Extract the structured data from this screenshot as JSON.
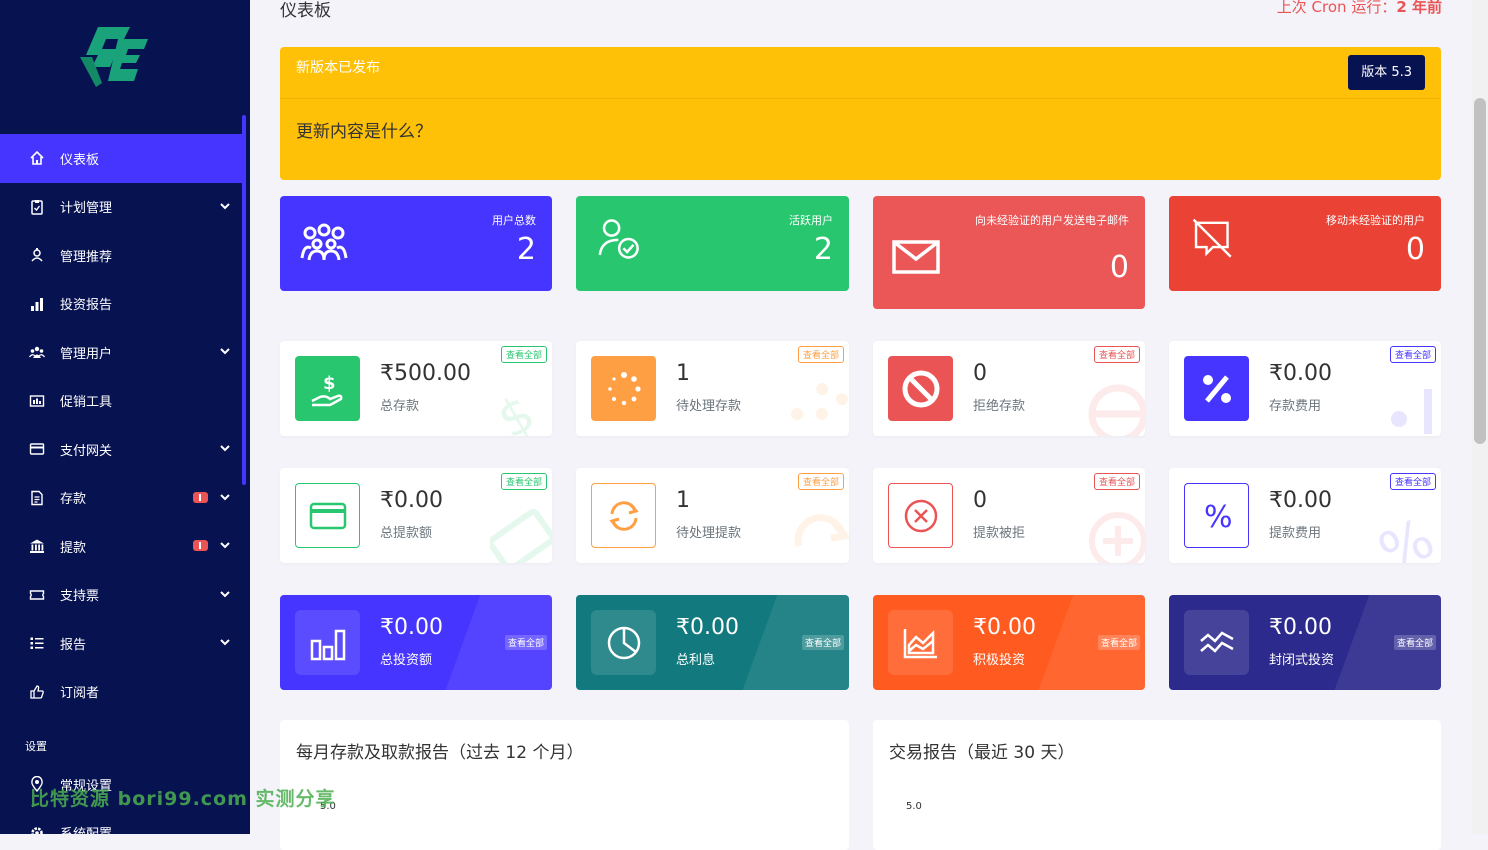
{
  "sidebar": {
    "items": [
      {
        "label": "仪表板",
        "icon": "home-icon",
        "active": true
      },
      {
        "label": "计划管理",
        "icon": "clipboard-icon",
        "has_submenu": true
      },
      {
        "label": "管理推荐",
        "icon": "referral-icon"
      },
      {
        "label": "投资报告",
        "icon": "bar-chart-icon"
      },
      {
        "label": "管理用户",
        "icon": "users-icon",
        "has_submenu": true
      },
      {
        "label": "促销工具",
        "icon": "promo-icon"
      },
      {
        "label": "支付网关",
        "icon": "credit-card-icon",
        "has_submenu": true
      },
      {
        "label": "存款",
        "icon": "deposit-icon",
        "has_submenu": true,
        "badge": "!"
      },
      {
        "label": "提款",
        "icon": "bank-icon",
        "has_submenu": true,
        "badge": "!"
      },
      {
        "label": "支持票",
        "icon": "ticket-icon",
        "has_submenu": true
      },
      {
        "label": "报告",
        "icon": "list-icon",
        "has_submenu": true
      },
      {
        "label": "订阅者",
        "icon": "thumbs-up-icon"
      }
    ],
    "settings_title": "设置",
    "settings_items": [
      {
        "label": "常规设置",
        "icon": "map-pin-icon"
      },
      {
        "label": "系统配置",
        "icon": "gear-icon"
      }
    ]
  },
  "header": {
    "title": "仪表板",
    "cron_label": "上次 Cron 运行：",
    "cron_value": "2 年前"
  },
  "notice": {
    "title": "新版本已发布",
    "version": "版本 5.3",
    "body": "更新内容是什么？"
  },
  "stats": [
    {
      "label": "用户总数",
      "value": "2",
      "color": "#4634ff",
      "icon": "users-group-icon"
    },
    {
      "label": "活跃用户",
      "value": "2",
      "color": "#28c76f",
      "icon": "user-check-icon"
    },
    {
      "label": "向未经验证的用户发送电子邮件",
      "value": "0",
      "color": "#eb5757",
      "icon": "envelope-icon"
    },
    {
      "label": "移动未经验证的用户",
      "value": "0",
      "color": "#ea4335",
      "icon": "comment-slash-icon"
    }
  ],
  "deposit_cards": [
    {
      "value": "₹500.00",
      "label": "总存款",
      "link": "查看全部",
      "color": "#28c76f",
      "icon": "hand-dollar-icon"
    },
    {
      "value": "1",
      "label": "待处理存款",
      "link": "查看全部",
      "color": "#ff9f43",
      "icon": "spinner-icon"
    },
    {
      "value": "0",
      "label": "拒绝存款",
      "link": "查看全部",
      "color": "#ea5455",
      "icon": "ban-icon"
    },
    {
      "value": "₹0.00",
      "label": "存款费用",
      "link": "查看全部",
      "color": "#4634ff",
      "icon": "percent-icon"
    }
  ],
  "withdraw_cards": [
    {
      "value": "₹0.00",
      "label": "总提款额",
      "link": "查看全部",
      "color": "#28c76f",
      "icon": "wallet-card-icon"
    },
    {
      "value": "1",
      "label": "待处理提款",
      "link": "查看全部",
      "color": "#ff9f43",
      "icon": "sync-icon"
    },
    {
      "value": "0",
      "label": "提款被拒",
      "link": "查看全部",
      "color": "#ea5455",
      "icon": "times-circle-icon"
    },
    {
      "value": "₹0.00",
      "label": "提款费用",
      "link": "查看全部",
      "color": "#4634ff",
      "icon": "percent-icon"
    }
  ],
  "invest_cards": [
    {
      "value": "₹0.00",
      "label": "总投资额",
      "link": "查看全部",
      "color": "#4634ff",
      "icon": "chart-bar-icon"
    },
    {
      "value": "₹0.00",
      "label": "总利息",
      "link": "查看全部",
      "color": "#127a7e",
      "icon": "chart-pie-icon"
    },
    {
      "value": "₹0.00",
      "label": "积极投资",
      "link": "查看全部",
      "color": "#ff5a1f",
      "icon": "chart-area-icon"
    },
    {
      "value": "₹0.00",
      "label": "封闭式投资",
      "link": "查看全部",
      "color": "#2d2a8e",
      "icon": "chart-line-icon"
    }
  ],
  "reports": [
    {
      "title": "每月存款及取款报告（过去 12 个月）",
      "tick": "5.0"
    },
    {
      "title": "交易报告（最近 30 天）",
      "tick": "5.0"
    }
  ],
  "watermark": "比特资源 bori99.com 实测分享"
}
